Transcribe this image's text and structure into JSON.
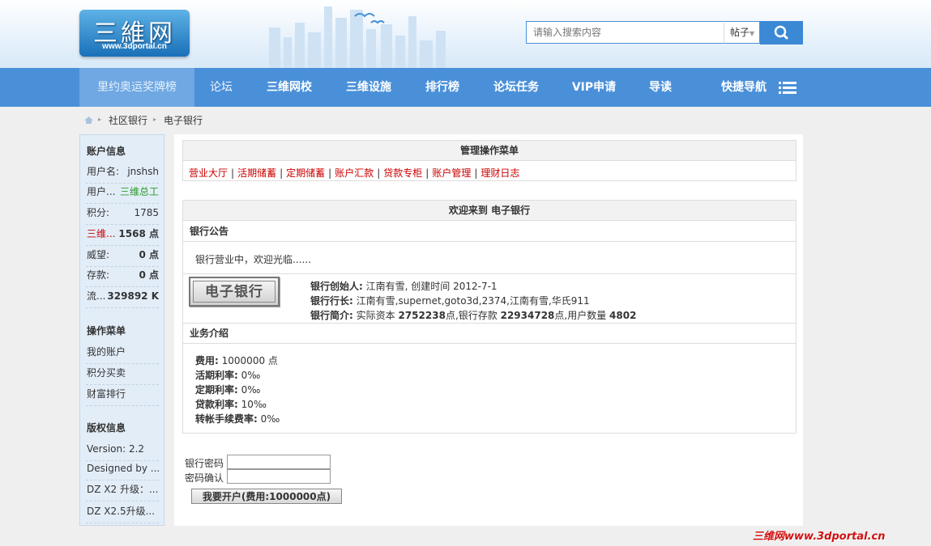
{
  "header": {
    "logo_text": "三維网",
    "logo_sub": "www.3dportal.cn",
    "search_placeholder": "请输入搜索内容",
    "search_type": "帖子",
    "search_icon": "search-icon"
  },
  "nav": {
    "items": [
      "里约奥运奖牌榜",
      "论坛",
      "三维网校",
      "三维设施",
      "排行榜",
      "论坛任务",
      "VIP申请",
      "导读",
      "快捷导航"
    ],
    "menu_icon": "list-icon"
  },
  "breadcrumb": {
    "home_icon": "home-icon",
    "items": [
      "社区银行",
      "电子银行"
    ]
  },
  "sidebar": {
    "account_title": "账户信息",
    "account_rows": [
      {
        "k": "用户名:",
        "v": "jnshsh"
      },
      {
        "k": "用户...",
        "v": "三维总工"
      },
      {
        "k": "积分:",
        "v": "1785"
      },
      {
        "k": "三维...",
        "v": "1568 点"
      },
      {
        "k": "威望:",
        "v": "0 点"
      },
      {
        "k": "存款:",
        "v": "0 点"
      },
      {
        "k": "流...",
        "v": "329892 K"
      }
    ],
    "ops_title": "操作菜单",
    "ops_items": [
      "我的账户",
      "积分买卖",
      "财富排行"
    ],
    "copyright_title": "版权信息",
    "copyright_items": [
      "Version: 2.2",
      "Designed by ...",
      "DZ X2 升级：...",
      "DZ X2.5升级..."
    ]
  },
  "manage": {
    "title": "管理操作菜单",
    "links": [
      "营业大厅",
      "活期储蓄",
      "定期储蓄",
      "账户汇款",
      "贷款专柜",
      "账户管理",
      "理财日志"
    ]
  },
  "welcome": {
    "title": "欢迎来到 电子银行",
    "notice_title": "银行公告",
    "notice_text": "银行营业中，欢迎光临......",
    "bank_logo": "电子银行",
    "founder_label": "银行创始人:",
    "founder_value": "江南有雪, 创建时间 2012-7-1",
    "president_label": "银行行长:",
    "president_value": "江南有雪,supernet,goto3d,2374,江南有雪,华氏911",
    "intro_label": "银行简介:",
    "intro_prefix": "实际资本",
    "capital": "2752238",
    "intro_mid": "点,银行存款",
    "deposits": "22934728",
    "intro_mid2": "点,用户数量",
    "users": "4802",
    "business_title": "业务介绍",
    "business": [
      {
        "k": "费用:",
        "v": "1000000 点"
      },
      {
        "k": "活期利率:",
        "v": "0‰"
      },
      {
        "k": "定期利率:",
        "v": "0‰"
      },
      {
        "k": "贷款利率:",
        "v": "10‰"
      },
      {
        "k": "转帐手续费率:",
        "v": "0‰"
      }
    ]
  },
  "form": {
    "password_label": "银行密码",
    "confirm_label": "密码确认",
    "submit_label": "我要开户(费用:1000000点)"
  },
  "watermark": "三维网www.3dportal.cn"
}
